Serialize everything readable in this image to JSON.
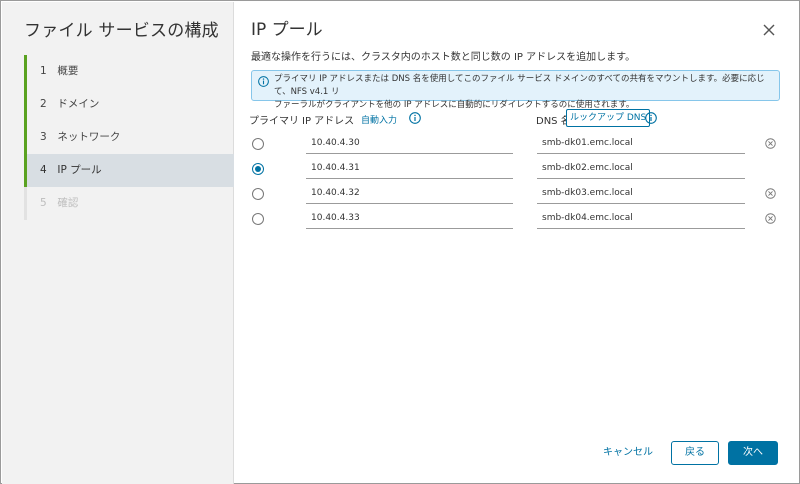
{
  "sidebar": {
    "title": "ファイル サービスの構成",
    "steps": [
      {
        "num": "1",
        "label": "概要"
      },
      {
        "num": "2",
        "label": "ドメイン"
      },
      {
        "num": "3",
        "label": "ネットワーク"
      },
      {
        "num": "4",
        "label": "IP プール"
      },
      {
        "num": "5",
        "label": "確認"
      }
    ]
  },
  "main": {
    "title": "IP プール",
    "subtitle": "最適な操作を行うには、クラスタ内のホスト数と同じ数の IP アドレスを追加します。",
    "info_line1": "プライマリ IP アドレスまたは DNS 名を使用してこのファイル サービス ドメインのすべての共有をマウントします。必要に応じて、NFS v4.1 リ",
    "info_line2": "ファーラルがクライアントを他の IP アドレスに自動的にリダイレクトするのに使用されます。",
    "headers": {
      "primary": "プライマリ",
      "ip": "IP アドレス",
      "autofill": "自動入力",
      "dns": "DNS 名",
      "lookup": "ルックアップ DNS"
    },
    "rows": [
      {
        "ip": "10.40.4.30",
        "dns": "smb-dk01.emc.local",
        "primary": false,
        "removable": true
      },
      {
        "ip": "10.40.4.31",
        "dns": "smb-dk02.emc.local",
        "primary": true,
        "removable": false
      },
      {
        "ip": "10.40.4.32",
        "dns": "smb-dk03.emc.local",
        "primary": false,
        "removable": true
      },
      {
        "ip": "10.40.4.33",
        "dns": "smb-dk04.emc.local",
        "primary": false,
        "removable": true
      }
    ]
  },
  "footer": {
    "cancel": "キャンセル",
    "back": "戻る",
    "next": "次へ"
  },
  "colors": {
    "accent": "#0072a3",
    "done": "#5aa220",
    "info_bg": "#e3f2fb"
  }
}
